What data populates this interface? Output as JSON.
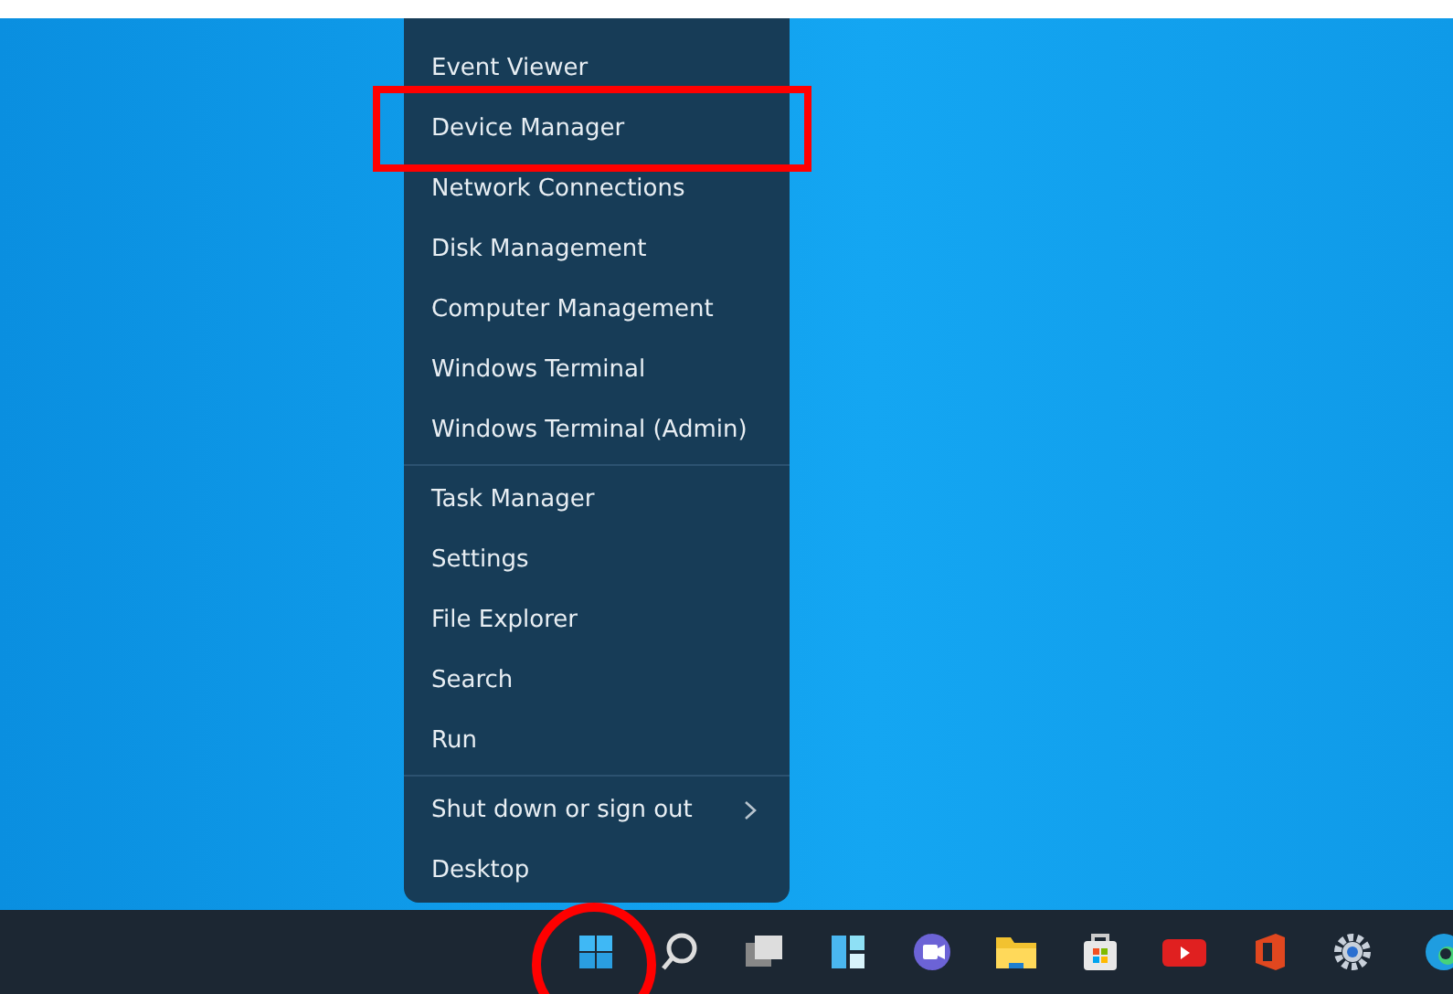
{
  "menu": {
    "groups": [
      {
        "items": [
          {
            "label": "Event Viewer",
            "kind": "plain"
          },
          {
            "label": "Device Manager",
            "kind": "plain"
          },
          {
            "label": "Network Connections",
            "kind": "plain"
          },
          {
            "label": "Disk Management",
            "kind": "plain"
          },
          {
            "label": "Computer Management",
            "kind": "plain"
          },
          {
            "label": "Windows Terminal",
            "kind": "plain"
          },
          {
            "label": "Windows Terminal (Admin)",
            "kind": "plain"
          }
        ]
      },
      {
        "items": [
          {
            "label": "Task Manager",
            "kind": "plain"
          },
          {
            "label": "Settings",
            "kind": "plain"
          },
          {
            "label": "File Explorer",
            "kind": "plain"
          },
          {
            "label": "Search",
            "kind": "plain"
          },
          {
            "label": "Run",
            "kind": "plain"
          }
        ]
      },
      {
        "items": [
          {
            "label": "Shut down or sign out",
            "kind": "submenu"
          },
          {
            "label": "Desktop",
            "kind": "plain"
          }
        ]
      }
    ]
  }
}
